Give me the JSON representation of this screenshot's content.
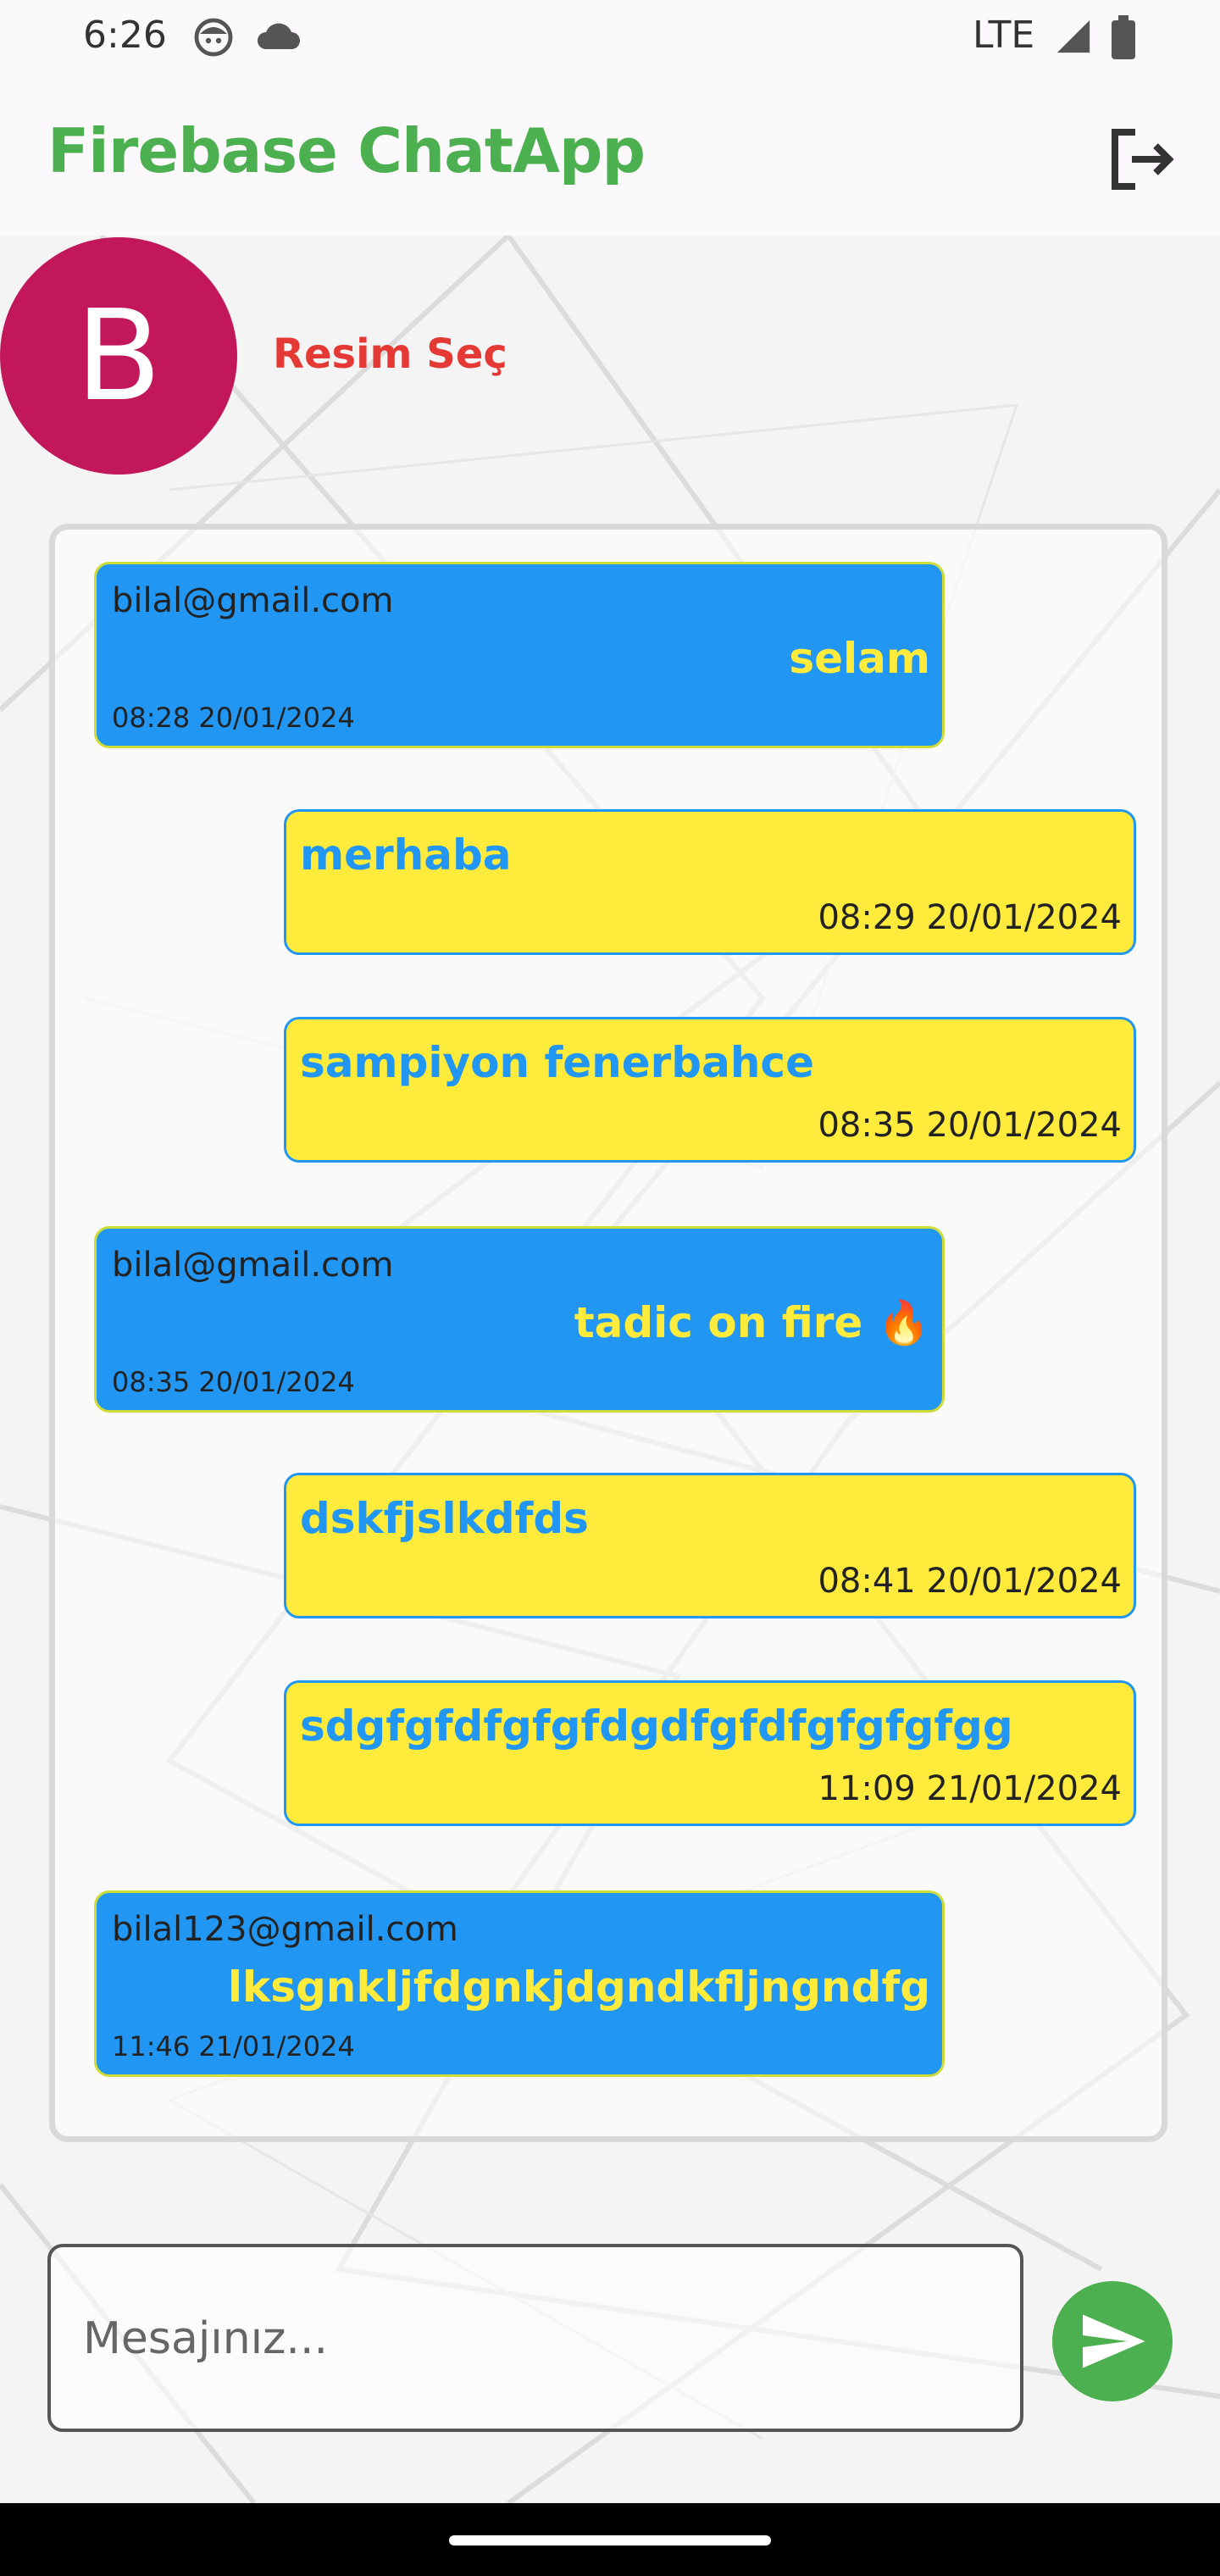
{
  "status_bar": {
    "time": "6:26",
    "network": "LTE",
    "icons": [
      "face-icon",
      "cloud-icon",
      "signal-icon",
      "battery-icon"
    ]
  },
  "app_bar": {
    "title": "Firebase ChatApp",
    "logout_icon": "logout-icon"
  },
  "profile": {
    "avatar_letter": "B",
    "pick_image_label": "Resim Seç"
  },
  "messages": [
    {
      "direction": "in",
      "sender": "bilal@gmail.com",
      "text": "selam",
      "time": "08:28 20/01/2024"
    },
    {
      "direction": "out",
      "text": "merhaba",
      "time": "08:29 20/01/2024"
    },
    {
      "direction": "out",
      "text": "sampiyon fenerbahce",
      "time": "08:35 20/01/2024"
    },
    {
      "direction": "in",
      "sender": "bilal@gmail.com",
      "text": "tadic on fire 🔥",
      "time": "08:35 20/01/2024"
    },
    {
      "direction": "out",
      "text": "dskfjslkdfds",
      "time": "08:41 20/01/2024"
    },
    {
      "direction": "out",
      "text": "sdgfgfdfgfgfdgdfgfdfgfgfgfgg",
      "time": "11:09 21/01/2024"
    },
    {
      "direction": "in",
      "sender": "bilal123@gmail.com",
      "text": "lksgnkljfdgnkjdgndkfljngndfg",
      "time": "11:46 21/01/2024"
    }
  ],
  "composer": {
    "placeholder": "Mesajınız...",
    "value": "",
    "send_icon": "send-icon"
  },
  "colors": {
    "accent_green": "#4caf50",
    "incoming_bubble": "#2196f3",
    "outgoing_bubble": "#ffeb3b",
    "avatar": "#c2185b",
    "pick_image": "#e53935"
  }
}
